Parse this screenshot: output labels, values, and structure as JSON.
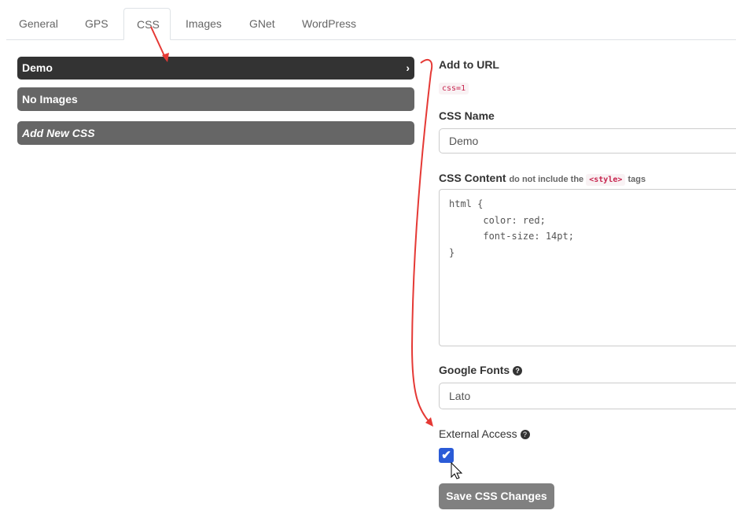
{
  "tabs": [
    {
      "label": "General"
    },
    {
      "label": "GPS"
    },
    {
      "label": "CSS",
      "active": true
    },
    {
      "label": "Images"
    },
    {
      "label": "GNet"
    },
    {
      "label": "WordPress"
    }
  ],
  "css_list": [
    {
      "label": "Demo",
      "selected": true
    },
    {
      "label": "No Images"
    },
    {
      "label": "Add New CSS"
    }
  ],
  "chevron": "›",
  "form": {
    "add_to_url_label": "Add to URL",
    "add_to_url_value": "css=1",
    "css_name_label": "CSS Name",
    "css_name_value": "Demo",
    "css_content_label": "CSS Content",
    "css_content_hint_pre": "do not include the",
    "css_content_hint_code": "<style>",
    "css_content_hint_post": "tags",
    "css_content_value": "html {\n      color: red;\n      font-size: 14pt;\n}",
    "google_fonts_label": "Google Fonts",
    "google_fonts_value": "Lato",
    "external_access_label": "External Access",
    "external_access_checked": true,
    "save_label": "Save CSS Changes",
    "help_glyph": "?",
    "check_glyph": "✔"
  },
  "colors": {
    "annotation": "#e53935",
    "checkbox": "#2a5bd7"
  }
}
